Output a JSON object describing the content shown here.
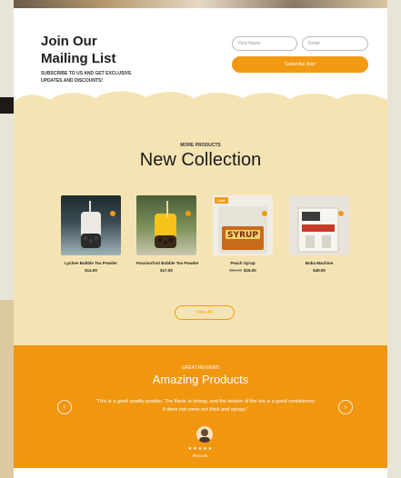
{
  "mailing": {
    "title_line1": "Join Our",
    "title_line2": "Mailing List",
    "subtitle": "SUBSCRIBE TO US AND GET EXCLUSIVE UPDATES AND DISCOUNTS!",
    "first_name_placeholder": "First Name",
    "email_placeholder": "Email",
    "subscribe_label": "Subscribe Now"
  },
  "collection": {
    "eyebrow": "MORE PRODUCTS",
    "title": "New Collection",
    "products": [
      {
        "name": "Lychee Bubble Tea Powder",
        "price": "$14.00",
        "old_price": "",
        "badge": ""
      },
      {
        "name": "Passionfruit Bubble Tea Powder",
        "price": "$17.00",
        "old_price": "",
        "badge": ""
      },
      {
        "name": "Peach Syrup",
        "price": "$16.00",
        "old_price": "$22.00",
        "badge": "Sale!",
        "label": "SYRUP"
      },
      {
        "name": "Boba Machine",
        "price": "$49.00",
        "old_price": "",
        "badge": ""
      }
    ],
    "view_all_label": "View All"
  },
  "reviews": {
    "eyebrow": "GREAT REVIEWS",
    "title": "Amazing Products",
    "quote": "\"This is a good quality powder. The flavor is strong, and the texture of the tea is a good consistency. It does not come out thick and syrupy.\"",
    "stars": "★★★★★",
    "reviewer": "Rena M.",
    "prev_icon": "chevron-left-icon",
    "next_icon": "chevron-right-icon"
  },
  "colors": {
    "accent": "#f29a12",
    "collection_bg": "#f5e4b3",
    "reviews_bg": "#f0960f"
  }
}
